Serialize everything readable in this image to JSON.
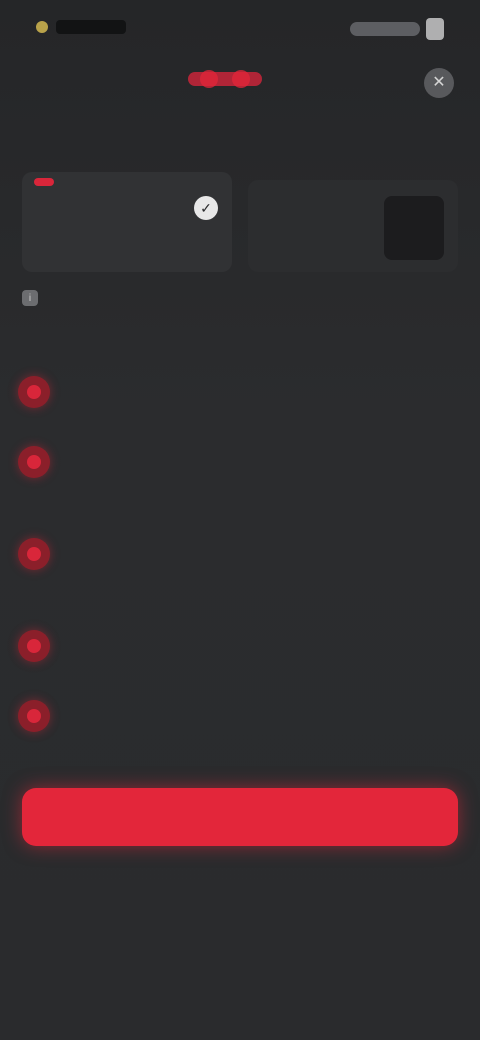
{
  "status_bar": {
    "time": "",
    "icons": [
      "signal-icon",
      "wifi-icon",
      "battery-icon"
    ]
  },
  "header": {
    "logo": "brand-logo",
    "title": "",
    "close_label": "✕"
  },
  "plan_card": {
    "badge": "",
    "name": "",
    "description": "",
    "check_label": "✓"
  },
  "alt_card": {
    "name": "",
    "description": ""
  },
  "info": {
    "text": ""
  },
  "features": [
    {
      "title": "",
      "description": ""
    },
    {
      "title": "",
      "description": ""
    },
    {
      "title": "",
      "description": ""
    },
    {
      "title": "",
      "description": ""
    },
    {
      "title": "",
      "description": ""
    }
  ],
  "cta": {
    "label": ""
  },
  "subtext": "",
  "secondary_link": "",
  "footer": {
    "links": [
      "",
      "",
      ""
    ]
  },
  "colors": {
    "accent": "#e3263a",
    "background": "#2a2b2d"
  }
}
